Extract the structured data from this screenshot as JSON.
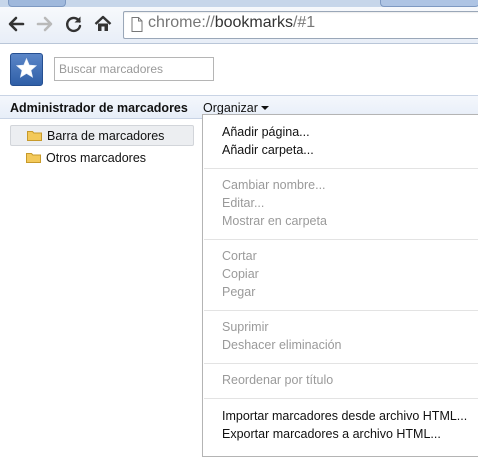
{
  "browser": {
    "url_prefix": "chrome://",
    "url_main": "bookmarks",
    "url_suffix": "/#1"
  },
  "search": {
    "placeholder": "Buscar marcadores"
  },
  "header": {
    "title": "Administrador de marcadores",
    "organize_label": "Organizar"
  },
  "tree": {
    "items": [
      {
        "label": "Barra de marcadores"
      },
      {
        "label": "Otros marcadores"
      }
    ]
  },
  "menu": {
    "items": [
      {
        "label": "Añadir página...",
        "enabled": true
      },
      {
        "label": "Añadir carpeta...",
        "enabled": true
      },
      {
        "label": "Cambiar nombre...",
        "enabled": false
      },
      {
        "label": "Editar...",
        "enabled": false
      },
      {
        "label": "Mostrar en carpeta",
        "enabled": false
      },
      {
        "label": "Cortar",
        "enabled": false
      },
      {
        "label": "Copiar",
        "enabled": false
      },
      {
        "label": "Pegar",
        "enabled": false
      },
      {
        "label": "Suprimir",
        "enabled": false
      },
      {
        "label": "Deshacer eliminación",
        "enabled": false
      },
      {
        "label": "Reordenar por título",
        "enabled": false
      },
      {
        "label": "Importar marcadores desde archivo HTML...",
        "enabled": true
      },
      {
        "label": "Exportar marcadores a archivo HTML...",
        "enabled": true
      }
    ]
  },
  "colors": {
    "accent": "#2f5fa7",
    "menu_disabled": "#9a9a9a",
    "folder": "#f3c95a"
  }
}
